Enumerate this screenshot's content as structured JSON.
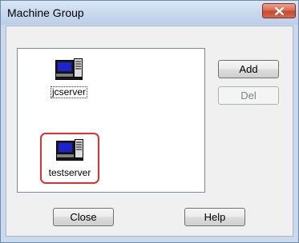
{
  "window": {
    "title": "Machine Group"
  },
  "machines": [
    {
      "name": "jcserver",
      "icon": "computer-icon"
    },
    {
      "name": "testserver",
      "icon": "computer-icon",
      "highlighted": true
    }
  ],
  "buttons": {
    "add": "Add",
    "del": "Del",
    "close": "Close",
    "help": "Help"
  },
  "colors": {
    "highlight": "#e03030",
    "title_close": "#c34a31"
  }
}
